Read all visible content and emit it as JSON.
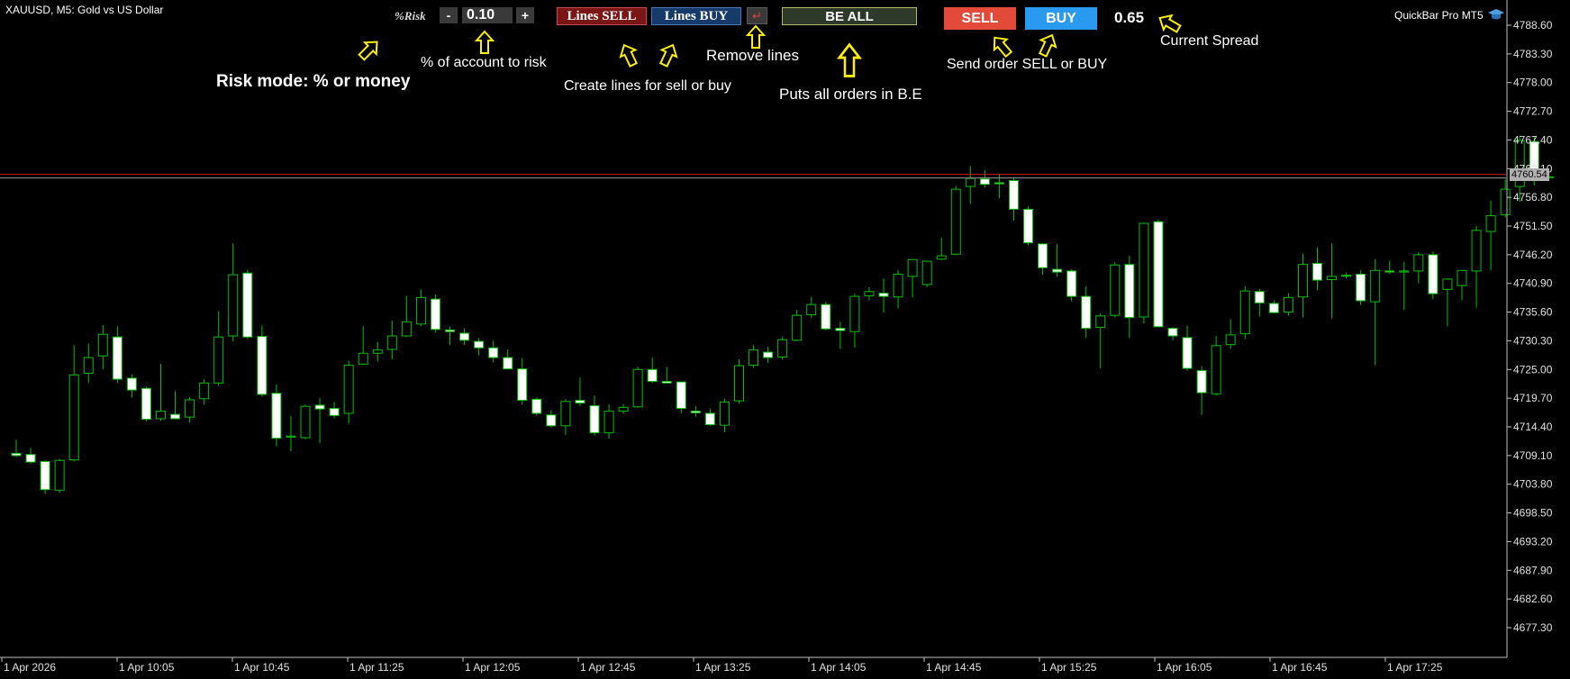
{
  "chart_header": {
    "symbol": "XAUUSD, M5:  Gold vs US Dollar",
    "indicator_name": "QuickBar Pro MT5"
  },
  "toolbar": {
    "risk_mode_label": "%Risk",
    "risk_minus": "-",
    "risk_value": "0.10",
    "risk_plus": "+",
    "lines_sell": "Lines SELL",
    "lines_buy": "Lines BUY",
    "remove_lines_icon": "↵",
    "be_all": "BE ALL",
    "sell": "SELL",
    "buy": "BUY",
    "spread": "0.65"
  },
  "annotations": {
    "risk_mode": "Risk mode: % or money",
    "percent_risk": "% of account to risk",
    "create_lines": "Create lines for sell or buy",
    "remove_lines": "Remove lines",
    "be_all": "Puts all orders in B.E",
    "send_order": "Send order SELL or BUY",
    "spread": "Current Spread"
  },
  "current_price_label": "4760.54",
  "colors": {
    "up": "#00c000",
    "down_body": "#ffffff",
    "bid_line": "#d01818",
    "arrow": "#ffef00",
    "sell_btn": "#e34a3a",
    "buy_btn": "#2a9af0"
  },
  "chart_data": {
    "type": "candlestick",
    "symbol": "XAUUSD",
    "timeframe": "M5",
    "y_ticks": [
      "4788.60",
      "4783.30",
      "4778.00",
      "4772.70",
      "4767.40",
      "4762.10",
      "4756.80",
      "4751.50",
      "4746.20",
      "4740.90",
      "4735.60",
      "4730.30",
      "4725.00",
      "4719.70",
      "4714.40",
      "4709.10",
      "4703.80",
      "4698.50",
      "4693.20",
      "4687.90",
      "4682.60",
      "4677.30"
    ],
    "x_ticks": [
      "1 Apr 2026",
      "1 Apr 10:05",
      "1 Apr 10:45",
      "1 Apr 11:25",
      "1 Apr 12:05",
      "1 Apr 12:45",
      "1 Apr 13:25",
      "1 Apr 14:05",
      "1 Apr 14:45",
      "1 Apr 15:25",
      "1 Apr 16:05",
      "1 Apr 16:45",
      "1 Apr 17:25"
    ],
    "ylim": [
      4673.0,
      4792.0
    ],
    "current_price": 4760.54,
    "ohlc": [
      [
        4709.5,
        4712.0,
        4708.8,
        4709.1
      ],
      [
        4709.3,
        4710.5,
        4707.6,
        4707.9
      ],
      [
        4708.0,
        4708.2,
        4702.0,
        4702.8
      ],
      [
        4702.7,
        4708.5,
        4702.2,
        4708.2
      ],
      [
        4708.3,
        4729.5,
        4708.0,
        4724.0
      ],
      [
        4724.3,
        4729.8,
        4722.5,
        4727.2
      ],
      [
        4727.5,
        4733.2,
        4725.0,
        4731.5
      ],
      [
        4731.0,
        4733.0,
        4722.5,
        4723.2
      ],
      [
        4723.4,
        4724.1,
        4719.8,
        4721.2
      ],
      [
        4721.5,
        4721.8,
        4715.4,
        4715.8
      ],
      [
        4715.9,
        4726.0,
        4715.5,
        4717.3
      ],
      [
        4716.7,
        4721.0,
        4715.8,
        4715.9
      ],
      [
        4716.2,
        4719.9,
        4715.2,
        4719.4
      ],
      [
        4719.6,
        4723.2,
        4718.5,
        4722.5
      ],
      [
        4722.5,
        4735.8,
        4722.0,
        4731.0
      ],
      [
        4731.2,
        4748.3,
        4730.2,
        4742.5
      ],
      [
        4742.8,
        4743.4,
        4730.6,
        4731.0
      ],
      [
        4731.1,
        4733.1,
        4720.0,
        4720.4
      ],
      [
        4720.6,
        4722.2,
        4710.8,
        4712.3
      ],
      [
        4712.5,
        4716.4,
        4709.9,
        4712.7
      ],
      [
        4712.4,
        4718.5,
        4712.1,
        4718.2
      ],
      [
        4718.4,
        4719.7,
        4711.4,
        4717.7
      ],
      [
        4717.8,
        4719.0,
        4716.0,
        4716.5
      ],
      [
        4716.9,
        4726.6,
        4715.0,
        4725.8
      ],
      [
        4726.0,
        4733.0,
        4725.8,
        4728.0
      ],
      [
        4728.0,
        4730.1,
        4726.5,
        4728.6
      ],
      [
        4728.7,
        4734.0,
        4726.9,
        4731.2
      ],
      [
        4731.2,
        4738.6,
        4731.0,
        4733.8
      ],
      [
        4733.4,
        4739.8,
        4733.0,
        4738.3
      ],
      [
        4738.0,
        4738.9,
        4731.8,
        4732.4
      ],
      [
        4732.3,
        4732.9,
        4729.5,
        4732.0
      ],
      [
        4731.7,
        4732.6,
        4729.5,
        4730.4
      ],
      [
        4730.2,
        4730.8,
        4727.6,
        4729.0
      ],
      [
        4729.0,
        4730.3,
        4726.3,
        4727.2
      ],
      [
        4727.2,
        4728.7,
        4725.8,
        4725.1
      ],
      [
        4725.1,
        4727.1,
        4718.5,
        4719.3
      ],
      [
        4719.5,
        4719.8,
        4716.5,
        4716.9
      ],
      [
        4716.6,
        4717.5,
        4714.3,
        4714.6
      ],
      [
        4714.6,
        4719.5,
        4712.9,
        4719.1
      ],
      [
        4719.3,
        4723.5,
        4718.2,
        4718.8
      ],
      [
        4718.3,
        4720.2,
        4712.8,
        4713.3
      ],
      [
        4713.3,
        4718.6,
        4712.2,
        4717.3
      ],
      [
        4717.3,
        4718.6,
        4716.8,
        4718.0
      ],
      [
        4718.1,
        4725.5,
        4717.9,
        4725.0
      ],
      [
        4725.0,
        4727.2,
        4722.5,
        4722.8
      ],
      [
        4722.8,
        4725.5,
        4722.5,
        4722.5
      ],
      [
        4722.7,
        4722.7,
        4716.9,
        4717.8
      ],
      [
        4717.3,
        4718.2,
        4716.3,
        4717.0
      ],
      [
        4716.9,
        4717.8,
        4714.6,
        4714.8
      ],
      [
        4714.7,
        4719.6,
        4713.4,
        4719.0
      ],
      [
        4719.2,
        4726.9,
        4718.7,
        4725.7
      ],
      [
        4725.8,
        4729.5,
        4725.3,
        4728.6
      ],
      [
        4728.2,
        4729.2,
        4726.2,
        4727.2
      ],
      [
        4727.3,
        4731.1,
        4726.8,
        4730.5
      ],
      [
        4730.4,
        4736.0,
        4730.2,
        4735.0
      ],
      [
        4735.1,
        4738.4,
        4734.5,
        4737.0
      ],
      [
        4737.0,
        4737.5,
        4732.2,
        4732.5
      ],
      [
        4732.6,
        4733.8,
        4728.8,
        4732.2
      ],
      [
        4732.0,
        4739.0,
        4729.0,
        4738.5
      ],
      [
        4738.6,
        4740.2,
        4737.8,
        4739.4
      ],
      [
        4739.1,
        4741.8,
        4735.5,
        4738.5
      ],
      [
        4738.4,
        4743.4,
        4736.3,
        4742.6
      ],
      [
        4742.2,
        4745.4,
        4738.3,
        4745.3
      ],
      [
        4740.7,
        4745.1,
        4740.2,
        4745.0
      ],
      [
        4745.4,
        4749.4,
        4745.2,
        4746.0
      ],
      [
        4746.3,
        4758.9,
        4746.1,
        4758.3
      ],
      [
        4758.8,
        4762.6,
        4755.6,
        4760.3
      ],
      [
        4760.2,
        4761.8,
        4758.6,
        4759.2
      ],
      [
        4759.5,
        4761.0,
        4756.6,
        4759.3
      ],
      [
        4759.9,
        4760.5,
        4752.5,
        4754.6
      ],
      [
        4754.6,
        4755.1,
        4747.9,
        4748.4
      ],
      [
        4748.2,
        4748.2,
        4742.5,
        4743.8
      ],
      [
        4743.5,
        4748.2,
        4742.1,
        4743.0
      ],
      [
        4743.2,
        4743.5,
        4737.6,
        4738.5
      ],
      [
        4738.5,
        4740.4,
        4730.8,
        4732.6
      ],
      [
        4732.8,
        4735.4,
        4725.2,
        4734.9
      ],
      [
        4735.0,
        4744.8,
        4734.6,
        4744.3
      ],
      [
        4744.4,
        4746.0,
        4730.8,
        4734.6
      ],
      [
        4734.7,
        4752.0,
        4733.5,
        4752.0
      ],
      [
        4752.3,
        4752.7,
        4732.8,
        4732.9
      ],
      [
        4732.6,
        4732.8,
        4730.4,
        4731.2
      ],
      [
        4730.9,
        4733.1,
        4724.8,
        4725.2
      ],
      [
        4724.8,
        4725.6,
        4716.6,
        4720.7
      ],
      [
        4720.5,
        4731.2,
        4720.2,
        4729.4
      ],
      [
        4729.6,
        4734.3,
        4728.8,
        4731.4
      ],
      [
        4731.6,
        4740.4,
        4730.6,
        4739.5
      ],
      [
        4739.4,
        4739.9,
        4734.8,
        4737.3
      ],
      [
        4737.2,
        4737.8,
        4735.4,
        4735.5
      ],
      [
        4735.6,
        4739.1,
        4734.9,
        4738.3
      ],
      [
        4738.4,
        4746.4,
        4734.6,
        4744.4
      ],
      [
        4744.6,
        4747.5,
        4739.6,
        4741.5
      ],
      [
        4741.6,
        4748.3,
        4734.4,
        4742.2
      ],
      [
        4742.3,
        4742.9,
        4741.8,
        4742.4
      ],
      [
        4742.6,
        4743.3,
        4736.9,
        4737.7
      ],
      [
        4737.5,
        4745.4,
        4725.8,
        4743.3
      ],
      [
        4743.2,
        4745.1,
        4742.6,
        4743.0
      ],
      [
        4743.0,
        4744.9,
        4736.0,
        4743.2
      ],
      [
        4743.2,
        4746.7,
        4740.9,
        4746.2
      ],
      [
        4746.2,
        4746.8,
        4738.0,
        4739.0
      ],
      [
        4739.8,
        4741.2,
        4733.0,
        4741.7
      ],
      [
        4740.5,
        4743.3,
        4737.8,
        4743.3
      ],
      [
        4743.2,
        4751.5,
        4736.4,
        4750.7
      ],
      [
        4750.5,
        4756.2,
        4743.3,
        4753.4
      ],
      [
        4753.6,
        4760.1,
        4753.1,
        4758.3
      ],
      [
        4758.8,
        4768.2,
        4756.0,
        4767.3
      ],
      [
        4767.1,
        4768.1,
        4759.0,
        4760.5
      ],
      [
        4760.6,
        4760.9,
        4760.3,
        4760.5
      ]
    ]
  }
}
